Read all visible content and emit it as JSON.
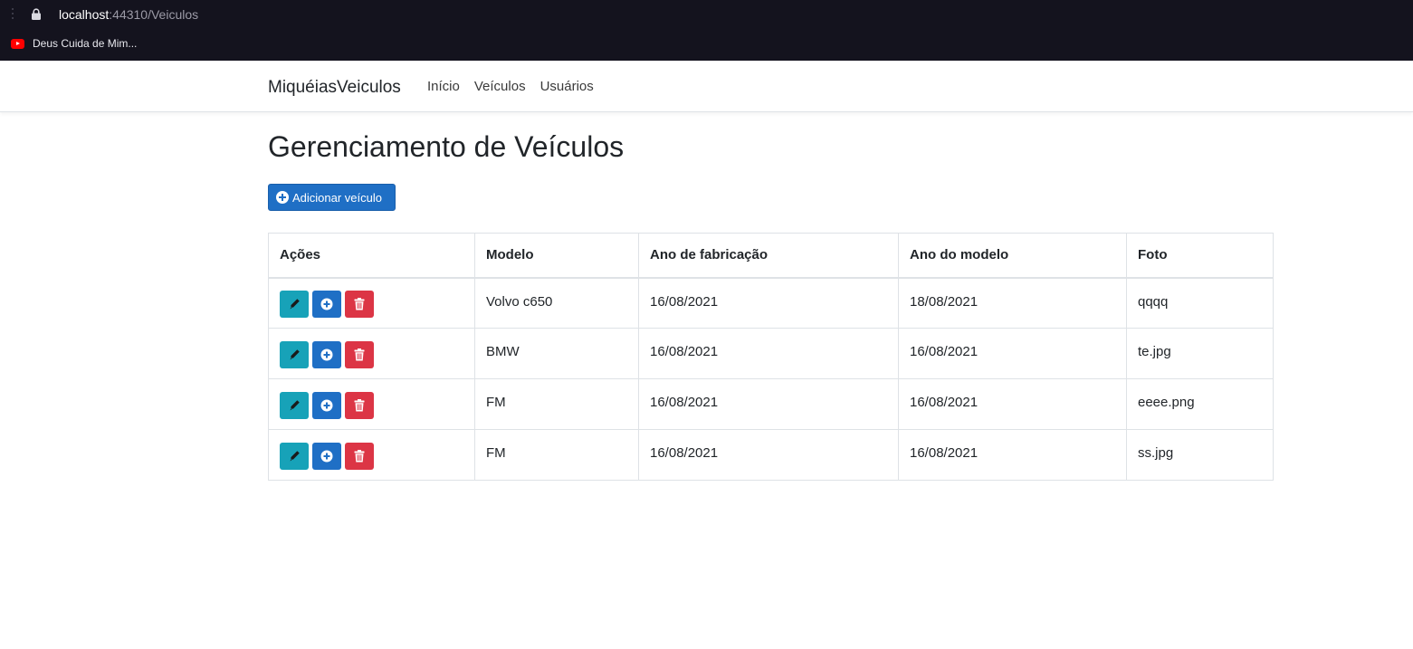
{
  "browser": {
    "url_host": "localhost",
    "url_path": ":44310/Veiculos",
    "bookmark_label": "Deus Cuida de Mim..."
  },
  "navbar": {
    "brand": "MiquéiasVeiculos",
    "links": [
      {
        "label": "Início"
      },
      {
        "label": "Veículos"
      },
      {
        "label": "Usuários"
      }
    ]
  },
  "page": {
    "title": "Gerenciamento de Veículos",
    "add_button_label": "Adicionar veículo"
  },
  "table": {
    "headers": [
      "Ações",
      "Modelo",
      "Ano de fabricação",
      "Ano do modelo",
      "Foto"
    ],
    "rows": [
      {
        "modelo": "Volvo c650",
        "ano_fabricacao": "16/08/2021",
        "ano_modelo": "18/08/2021",
        "foto": "qqqq"
      },
      {
        "modelo": "BMW",
        "ano_fabricacao": "16/08/2021",
        "ano_modelo": "16/08/2021",
        "foto": "te.jpg"
      },
      {
        "modelo": "FM",
        "ano_fabricacao": "16/08/2021",
        "ano_modelo": "16/08/2021",
        "foto": "eeee.png"
      },
      {
        "modelo": "FM",
        "ano_fabricacao": "16/08/2021",
        "ano_modelo": "16/08/2021",
        "foto": "ss.jpg"
      }
    ],
    "action_icons": [
      "pencil-icon",
      "plus-circle-icon",
      "trash-icon"
    ]
  },
  "colors": {
    "primary": "#1f6fc5",
    "info": "#17a2b8",
    "danger": "#dc3545",
    "chrome_bg": "#14131e"
  }
}
